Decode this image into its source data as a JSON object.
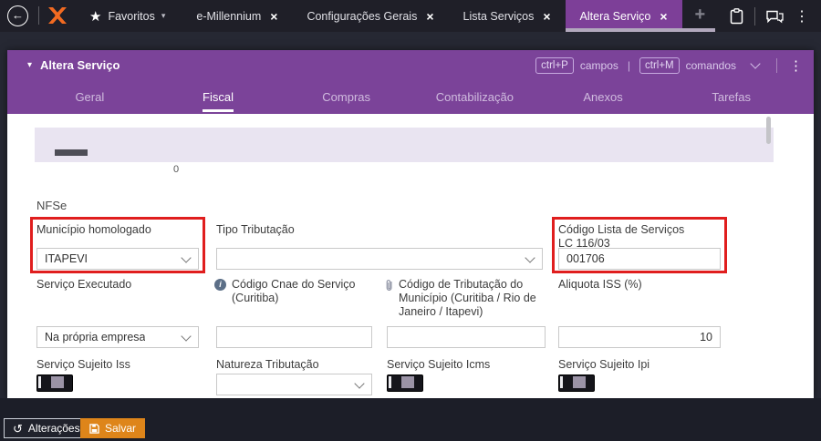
{
  "icons": {
    "back": "←",
    "star": "★",
    "caret_down": "▾",
    "close": "×",
    "plus": "+",
    "dots": "⋮",
    "info": "i",
    "undo": "↺"
  },
  "topbar": {
    "favorites": "Favoritos",
    "tabs": [
      {
        "label": "e-Millennium"
      },
      {
        "label": "Configurações Gerais"
      },
      {
        "label": "Lista Serviços"
      },
      {
        "label": "Altera Serviço"
      }
    ]
  },
  "window": {
    "title": "Altera Serviço",
    "shortcuts": {
      "campos_key": "ctrl+P",
      "campos_label": "campos",
      "separator": "|",
      "comandos_key": "ctrl+M",
      "comandos_label": "comandos"
    },
    "tabs": [
      "Geral",
      "Fiscal",
      "Compras",
      "Contabilização",
      "Anexos",
      "Tarefas"
    ]
  },
  "chart": {
    "tick": "0"
  },
  "form": {
    "section": "NFSe",
    "municipio_label": "Município homologado",
    "municipio_value": "ITAPEVI",
    "tipo_label": "Tipo Tributação",
    "codigo_lista_label1": "Código Lista de Serviços",
    "codigo_lista_label2": "LC 116/03",
    "codigo_lista_value": "001706",
    "servico_executado_label": "Serviço Executado",
    "servico_executado_value": "Na própria empresa",
    "cnae_label": "Código Cnae do Serviço (Curitiba)",
    "trib_municipio_label": "Código de Tributação do Município (Curitiba / Rio de Janeiro / Itapevi)",
    "aliquota_label": "Aliquota ISS (%)",
    "aliquota_value": "10",
    "sujeito_iss_label": "Serviço Sujeito Iss",
    "natureza_label": "Natureza Tributação",
    "sujeito_icms_label": "Serviço Sujeito Icms",
    "sujeito_ipi_label": "Serviço Sujeito Ipi"
  },
  "footer": {
    "alteracoes": "Alterações",
    "salvar": "Salvar"
  },
  "colors": {
    "purple": "#7b4399",
    "topbar": "#1f1f28",
    "accent_orange": "#de851a",
    "annotation_red": "#e01e1e"
  }
}
